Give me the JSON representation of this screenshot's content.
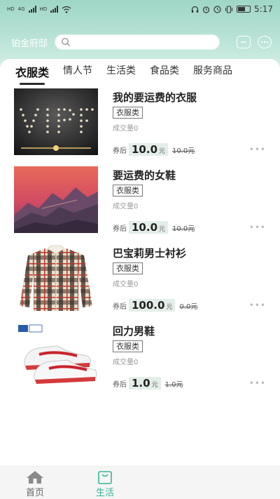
{
  "status_bar": {
    "sim1": "HD",
    "sim2": "HD",
    "network": "4G",
    "time": "5:17",
    "icons": [
      "headphones-icon",
      "alarm-icon",
      "clock-icon",
      "vibrate-icon",
      "battery-icon"
    ]
  },
  "header": {
    "location": "铂金府邸",
    "search_placeholder": "",
    "icons": [
      "scan-icon",
      "message-icon"
    ]
  },
  "tabs": [
    {
      "label": "衣服类",
      "active": true
    },
    {
      "label": "情人节",
      "active": false
    },
    {
      "label": "生活类",
      "active": false
    },
    {
      "label": "食品类",
      "active": false
    },
    {
      "label": "服务商品",
      "active": false
    }
  ],
  "products": [
    {
      "title": "我的要运费的衣服",
      "category": "衣服类",
      "sales": "成交量0",
      "coupon_label": "券后",
      "price": "10.0",
      "unit": "元",
      "original_price": "10.0元",
      "image": "vip-banner-image"
    },
    {
      "title": "要运费的女鞋",
      "category": "衣服类",
      "sales": "成交量0",
      "coupon_label": "券后",
      "price": "10.0",
      "unit": "元",
      "original_price": "10.0元",
      "image": "mountain-landscape-image"
    },
    {
      "title": "巴宝莉男士衬衫",
      "category": "衣服类",
      "sales": "成交量0",
      "coupon_label": "券后",
      "price": "100.0",
      "unit": "元",
      "original_price": "0.0元",
      "image": "plaid-shirt-image"
    },
    {
      "title": "回力男鞋",
      "category": "衣服类",
      "sales": "成交量0",
      "coupon_label": "券后",
      "price": "1.0",
      "unit": "元",
      "original_price": "1.0元",
      "image": "sneakers-image"
    }
  ],
  "bottom_nav": [
    {
      "label": "首页",
      "icon": "home-icon",
      "active": false
    },
    {
      "label": "生活",
      "icon": "bag-icon",
      "active": true
    }
  ],
  "colors": {
    "accent": "#3ab497",
    "header_gradient_top": "#9fd6c6",
    "price_bg": "#e3eee8"
  }
}
